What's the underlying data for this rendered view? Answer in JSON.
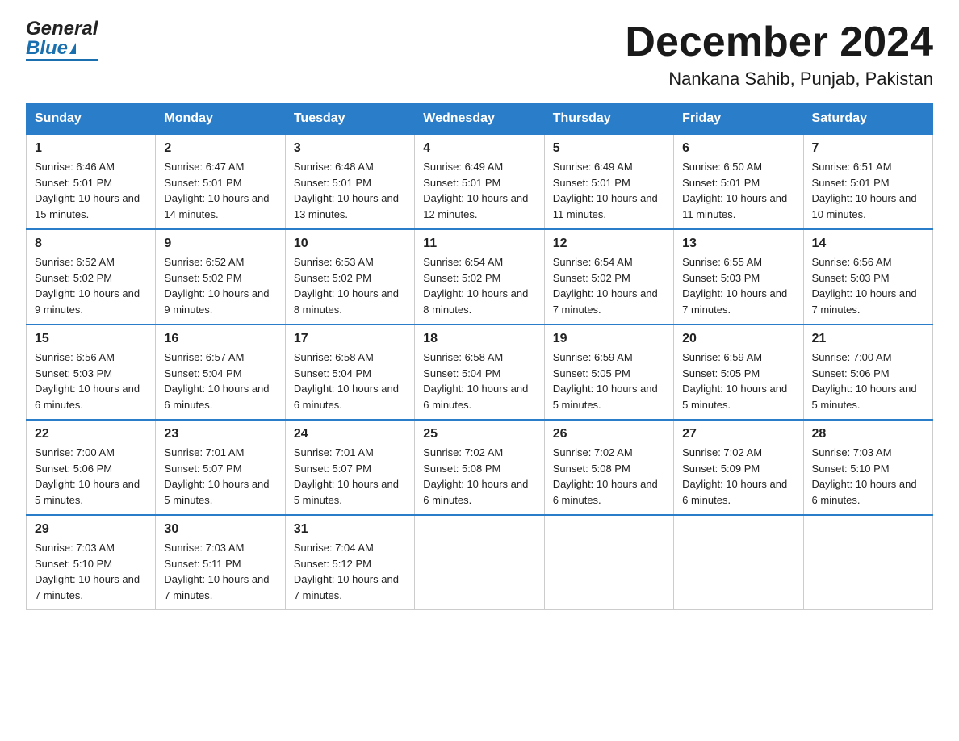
{
  "header": {
    "logo_general": "General",
    "logo_blue": "Blue",
    "month_title": "December 2024",
    "location": "Nankana Sahib, Punjab, Pakistan"
  },
  "weekdays": [
    "Sunday",
    "Monday",
    "Tuesday",
    "Wednesday",
    "Thursday",
    "Friday",
    "Saturday"
  ],
  "weeks": [
    [
      {
        "day": "1",
        "sunrise": "6:46 AM",
        "sunset": "5:01 PM",
        "daylight": "10 hours and 15 minutes."
      },
      {
        "day": "2",
        "sunrise": "6:47 AM",
        "sunset": "5:01 PM",
        "daylight": "10 hours and 14 minutes."
      },
      {
        "day": "3",
        "sunrise": "6:48 AM",
        "sunset": "5:01 PM",
        "daylight": "10 hours and 13 minutes."
      },
      {
        "day": "4",
        "sunrise": "6:49 AM",
        "sunset": "5:01 PM",
        "daylight": "10 hours and 12 minutes."
      },
      {
        "day": "5",
        "sunrise": "6:49 AM",
        "sunset": "5:01 PM",
        "daylight": "10 hours and 11 minutes."
      },
      {
        "day": "6",
        "sunrise": "6:50 AM",
        "sunset": "5:01 PM",
        "daylight": "10 hours and 11 minutes."
      },
      {
        "day": "7",
        "sunrise": "6:51 AM",
        "sunset": "5:01 PM",
        "daylight": "10 hours and 10 minutes."
      }
    ],
    [
      {
        "day": "8",
        "sunrise": "6:52 AM",
        "sunset": "5:02 PM",
        "daylight": "10 hours and 9 minutes."
      },
      {
        "day": "9",
        "sunrise": "6:52 AM",
        "sunset": "5:02 PM",
        "daylight": "10 hours and 9 minutes."
      },
      {
        "day": "10",
        "sunrise": "6:53 AM",
        "sunset": "5:02 PM",
        "daylight": "10 hours and 8 minutes."
      },
      {
        "day": "11",
        "sunrise": "6:54 AM",
        "sunset": "5:02 PM",
        "daylight": "10 hours and 8 minutes."
      },
      {
        "day": "12",
        "sunrise": "6:54 AM",
        "sunset": "5:02 PM",
        "daylight": "10 hours and 7 minutes."
      },
      {
        "day": "13",
        "sunrise": "6:55 AM",
        "sunset": "5:03 PM",
        "daylight": "10 hours and 7 minutes."
      },
      {
        "day": "14",
        "sunrise": "6:56 AM",
        "sunset": "5:03 PM",
        "daylight": "10 hours and 7 minutes."
      }
    ],
    [
      {
        "day": "15",
        "sunrise": "6:56 AM",
        "sunset": "5:03 PM",
        "daylight": "10 hours and 6 minutes."
      },
      {
        "day": "16",
        "sunrise": "6:57 AM",
        "sunset": "5:04 PM",
        "daylight": "10 hours and 6 minutes."
      },
      {
        "day": "17",
        "sunrise": "6:58 AM",
        "sunset": "5:04 PM",
        "daylight": "10 hours and 6 minutes."
      },
      {
        "day": "18",
        "sunrise": "6:58 AM",
        "sunset": "5:04 PM",
        "daylight": "10 hours and 6 minutes."
      },
      {
        "day": "19",
        "sunrise": "6:59 AM",
        "sunset": "5:05 PM",
        "daylight": "10 hours and 5 minutes."
      },
      {
        "day": "20",
        "sunrise": "6:59 AM",
        "sunset": "5:05 PM",
        "daylight": "10 hours and 5 minutes."
      },
      {
        "day": "21",
        "sunrise": "7:00 AM",
        "sunset": "5:06 PM",
        "daylight": "10 hours and 5 minutes."
      }
    ],
    [
      {
        "day": "22",
        "sunrise": "7:00 AM",
        "sunset": "5:06 PM",
        "daylight": "10 hours and 5 minutes."
      },
      {
        "day": "23",
        "sunrise": "7:01 AM",
        "sunset": "5:07 PM",
        "daylight": "10 hours and 5 minutes."
      },
      {
        "day": "24",
        "sunrise": "7:01 AM",
        "sunset": "5:07 PM",
        "daylight": "10 hours and 5 minutes."
      },
      {
        "day": "25",
        "sunrise": "7:02 AM",
        "sunset": "5:08 PM",
        "daylight": "10 hours and 6 minutes."
      },
      {
        "day": "26",
        "sunrise": "7:02 AM",
        "sunset": "5:08 PM",
        "daylight": "10 hours and 6 minutes."
      },
      {
        "day": "27",
        "sunrise": "7:02 AM",
        "sunset": "5:09 PM",
        "daylight": "10 hours and 6 minutes."
      },
      {
        "day": "28",
        "sunrise": "7:03 AM",
        "sunset": "5:10 PM",
        "daylight": "10 hours and 6 minutes."
      }
    ],
    [
      {
        "day": "29",
        "sunrise": "7:03 AM",
        "sunset": "5:10 PM",
        "daylight": "10 hours and 7 minutes."
      },
      {
        "day": "30",
        "sunrise": "7:03 AM",
        "sunset": "5:11 PM",
        "daylight": "10 hours and 7 minutes."
      },
      {
        "day": "31",
        "sunrise": "7:04 AM",
        "sunset": "5:12 PM",
        "daylight": "10 hours and 7 minutes."
      },
      null,
      null,
      null,
      null
    ]
  ],
  "labels": {
    "sunrise_prefix": "Sunrise: ",
    "sunset_prefix": "Sunset: ",
    "daylight_prefix": "Daylight: "
  }
}
